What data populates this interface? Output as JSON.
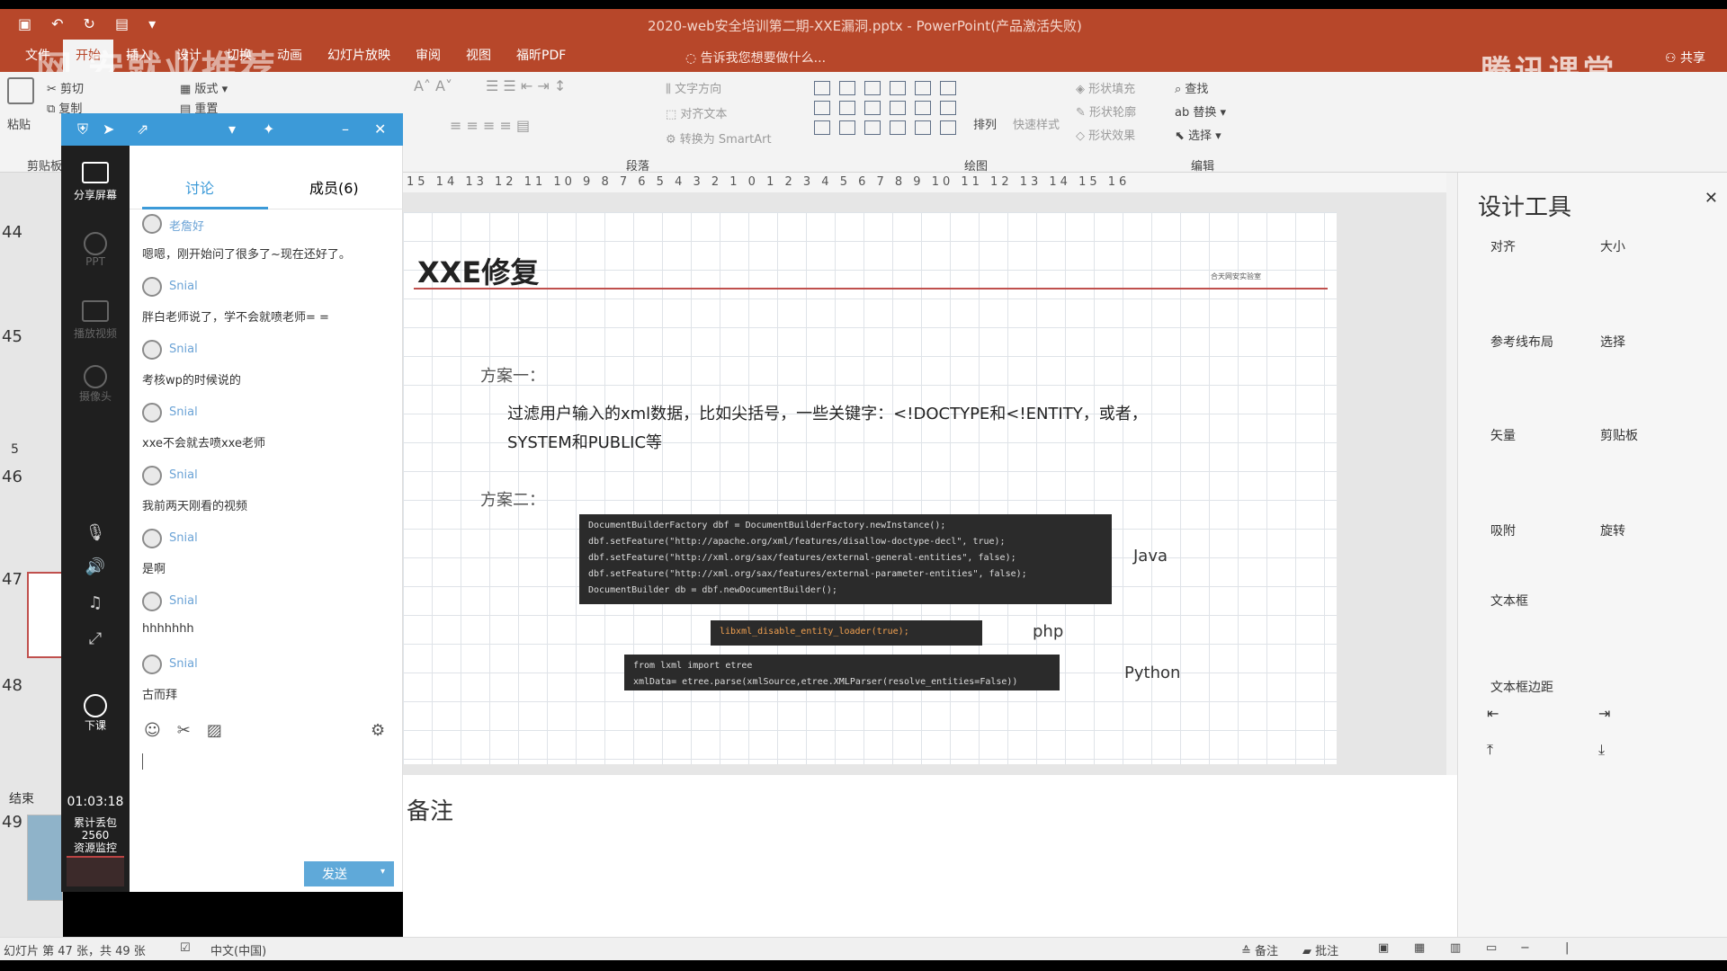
{
  "titlebar": {
    "title": "2020-web安全培训第二期-XXE漏洞.pptx - PowerPoint(产品激活失败)",
    "quick_access": [
      "save-icon",
      "undo-icon",
      "redo-icon",
      "present-icon"
    ]
  },
  "menubar": {
    "tabs": [
      "文件",
      "开始",
      "插入",
      "设计",
      "切换",
      "动画",
      "幻灯片放映",
      "审阅",
      "视图",
      "福昕PDF"
    ],
    "active_tab": "开始",
    "tell_me": "告诉我您想要做什么...",
    "share": "共享",
    "brand": "腾讯课堂",
    "overlay_text": "网 安就业推荐"
  },
  "ribbon": {
    "clipboard": {
      "paste": "粘贴",
      "cut": "剪切",
      "copy": "复制",
      "label": "剪贴板"
    },
    "slides": {
      "layout": "版式",
      "reset": "重置"
    },
    "paragraph": {
      "text_direction": "文字方向",
      "align_text": "对齐文本",
      "smartart": "转换为 SmartArt",
      "label": "段落"
    },
    "drawing": {
      "arrange": "排列",
      "quick_styles": "快速样式",
      "fill": "形状填充",
      "outline": "形状轮廓",
      "effects": "形状效果",
      "label": "绘图"
    },
    "editing": {
      "find": "查找",
      "replace": "替换",
      "select": "选择",
      "label": "编辑"
    }
  },
  "thumbnails": {
    "numbers": [
      "44",
      "45",
      "46",
      "47",
      "48",
      "49"
    ],
    "section_5": "5",
    "section_end": "结束"
  },
  "tool_strip": {
    "share_screen": "分享屏幕",
    "ppt": "PPT",
    "play_video": "播放视频",
    "camera": "摄像头",
    "end_class": "下课",
    "timer": "01:03:18",
    "packet_loss_label": "累计丢包",
    "packet_loss_value": "2560",
    "resource_monitor": "资源监控"
  },
  "chat": {
    "tab_discuss": "讨论",
    "tab_members": "成员(6)",
    "messages": [
      {
        "user": "老詹好",
        "text": "嗯嗯，刚开始问了很多了~现在还好了。"
      },
      {
        "user": "Snial",
        "text": "胖白老师说了，学不会就喷老师= ="
      },
      {
        "user": "Snial",
        "text": "考核wp的时候说的"
      },
      {
        "user": "Snial",
        "text": "xxe不会就去喷xxe老师"
      },
      {
        "user": "Snial",
        "text": "我前两天刚看的视频"
      },
      {
        "user": "Snial",
        "text": "是啊"
      },
      {
        "user": "Snial",
        "text": "hhhhhhh"
      },
      {
        "user": "Snial",
        "text": "古而拜"
      }
    ],
    "send": "发送"
  },
  "ruler": "15 14 13 12 11 10 9 8 7 6 5 4 3 2 1 0 1 2 3 4 5 6 7 8 9 10 11 12 13 14 15 16",
  "slide": {
    "title": "XXE修复",
    "logo_text": "合天网安实验室",
    "plan1": "方案一：",
    "plan1_text_line1": "过滤用户输入的xml数据，比如尖括号，一些关键字：<!DOCTYPE和<!ENTITY，或者，",
    "plan1_text_line2": "SYSTEM和PUBLIC等",
    "plan2": "方案二：",
    "java_code": "DocumentBuilderFactory dbf = DocumentBuilderFactory.newInstance();\ndbf.setFeature(\"http://apache.org/xml/features/disallow-doctype-decl\", true);\ndbf.setFeature(\"http://xml.org/sax/features/external-general-entities\", false);\ndbf.setFeature(\"http://xml.org/sax/features/external-parameter-entities\", false);\nDocumentBuilder db = dbf.newDocumentBuilder();",
    "java_label": "Java",
    "php_code": "libxml_disable_entity_loader(true);",
    "php_label": "php",
    "python_code": "from lxml import etree\nxmlData= etree.parse(xmlSource,etree.XMLParser(resolve_entities=False))",
    "python_label": "Python"
  },
  "notes": {
    "label": "备注"
  },
  "design_pane": {
    "title": "设计工具",
    "sections": [
      "对齐",
      "大小",
      "参考线布局",
      "选择",
      "矢量",
      "剪贴板",
      "吸附",
      "旋转",
      "文本框",
      "文本框边距"
    ]
  },
  "statusbar": {
    "slide_info": "幻灯片 第 47 张，共 49 张",
    "language": "中文(中国)",
    "notes": "备注",
    "comments": "批注"
  }
}
